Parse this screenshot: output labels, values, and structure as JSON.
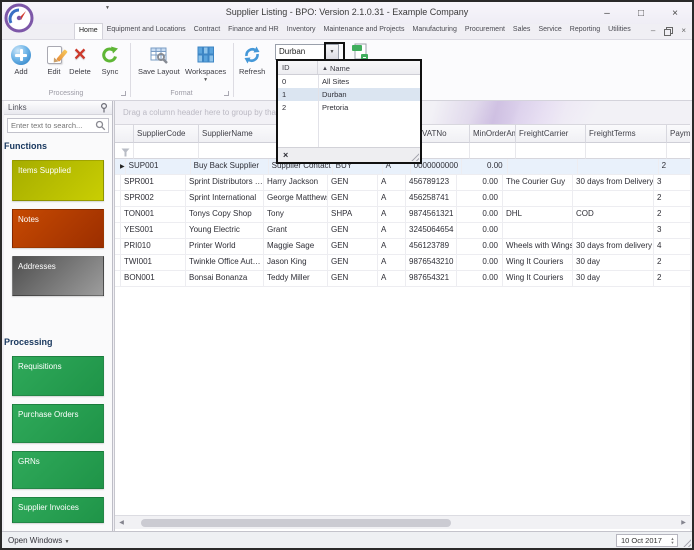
{
  "window": {
    "title": "Supplier Listing - BPO: Version 2.1.0.31 - Example Company"
  },
  "icons": {
    "minimize": "–",
    "maximize": "□",
    "close": "×",
    "mdi_minimize": "–",
    "mdi_close": "×",
    "qat_arrow": "▼",
    "combo_arrow": "▼",
    "sort_asc": "▲",
    "row_arrow": "▶",
    "list_close": "×",
    "scroll_left": "◀",
    "scroll_right": "▶",
    "open_windows_arrow": "▼",
    "spin_up": "▲",
    "spin_down": "▼"
  },
  "ribbon": {
    "tabs": [
      {
        "label": "Home",
        "active": true
      },
      {
        "label": "Equipment and Locations"
      },
      {
        "label": "Contract"
      },
      {
        "label": "Finance and HR"
      },
      {
        "label": "Inventory"
      },
      {
        "label": "Maintenance and Projects"
      },
      {
        "label": "Manufacturing"
      },
      {
        "label": "Procurement"
      },
      {
        "label": "Sales"
      },
      {
        "label": "Service"
      },
      {
        "label": "Reporting"
      },
      {
        "label": "Utilities"
      }
    ],
    "buttons": {
      "add": "Add",
      "edit": "Edit",
      "delete": "Delete",
      "sync": "Sync",
      "save_layout": "Save Layout",
      "workspaces": "Workspaces",
      "refresh": "Refresh"
    },
    "group_captions": {
      "processing": "Processing",
      "format": "Format"
    }
  },
  "site_selector": {
    "value": "Durban",
    "columns": {
      "id": "ID",
      "name": "Name"
    },
    "options": [
      {
        "id": "0",
        "name": "All Sites"
      },
      {
        "id": "1",
        "name": "Durban",
        "selected": true
      },
      {
        "id": "2",
        "name": "Pretoria"
      }
    ]
  },
  "sidebar": {
    "panel_title": "Links",
    "search_placeholder": "Enter text to search...",
    "sections": [
      {
        "heading": "Functions",
        "tiles": [
          {
            "label": "Items Supplied",
            "gradient": [
              "#a6ad00",
              "#c9ce02"
            ]
          },
          {
            "label": "Notes",
            "gradient": [
              "#c64a02",
              "#9c2e00"
            ]
          },
          {
            "label": "Addresses",
            "gradient": [
              "#4e4e4e",
              "#9d9d9d"
            ]
          }
        ]
      },
      {
        "heading": "Processing",
        "tiles": [
          {
            "label": "Requisitions",
            "gradient": [
              "#2fa95a",
              "#1f9448"
            ]
          },
          {
            "label": "Purchase Orders",
            "gradient": [
              "#2fa95a",
              "#1f9448"
            ]
          },
          {
            "label": "GRNs",
            "gradient": [
              "#2fa95a",
              "#1f9448"
            ]
          },
          {
            "label": "Supplier Invoices",
            "gradient": [
              "#2fa95a",
              "#1f9448"
            ]
          }
        ]
      }
    ]
  },
  "grid": {
    "group_by_hint": "Drag a column header here to group by that column",
    "columns": [
      "SupplierCode",
      "SupplierName",
      "",
      "",
      "",
      "VATNo",
      "MinOrderAmt",
      "FreightCarrier",
      "FreightTerms",
      "Paymen"
    ],
    "rows": [
      {
        "selected": true,
        "cells": [
          "SUP001",
          "Buy Back Supplier",
          "Supplier Contact",
          "BUY",
          "A",
          "0000000000",
          "0.00",
          "",
          "",
          "2"
        ]
      },
      {
        "cells": [
          "SPR001",
          "Sprint Distributors Local",
          "Harry Jackson",
          "GEN",
          "A",
          "456789123",
          "0.00",
          "The Courier Guy",
          "30 days from Delivery",
          "3"
        ]
      },
      {
        "cells": [
          "SPR002",
          "Sprint International",
          "George Matthews",
          "GEN",
          "A",
          "456258741",
          "0.00",
          "",
          "",
          "2"
        ]
      },
      {
        "cells": [
          "TON001",
          "Tonys Copy Shop",
          "Tony",
          "SHPA",
          "A",
          "9874561321",
          "0.00",
          "DHL",
          "COD",
          "2"
        ]
      },
      {
        "cells": [
          "YES001",
          "Young Electric",
          "Grant",
          "GEN",
          "A",
          "3245064654",
          "0.00",
          "",
          "",
          "3"
        ]
      },
      {
        "cells": [
          "PRI010",
          "Printer World",
          "Maggie Sage",
          "GEN",
          "A",
          "456123789",
          "0.00",
          "Wheels with Wings",
          "30 days from delivery",
          "4"
        ]
      },
      {
        "cells": [
          "TWI001",
          "Twinkle Office Automation",
          "Jason King",
          "GEN",
          "A",
          "9876543210",
          "0.00",
          "Wing It Couriers",
          "30 day",
          "2"
        ]
      },
      {
        "cells": [
          "BON001",
          "Bonsai Bonanza",
          "Teddy Miller",
          "GEN",
          "A",
          "987654321",
          "0.00",
          "Wing It Couriers",
          "30 day",
          "2"
        ]
      }
    ]
  },
  "statusbar": {
    "open_windows": "Open Windows",
    "date": "10 Oct 2017"
  }
}
